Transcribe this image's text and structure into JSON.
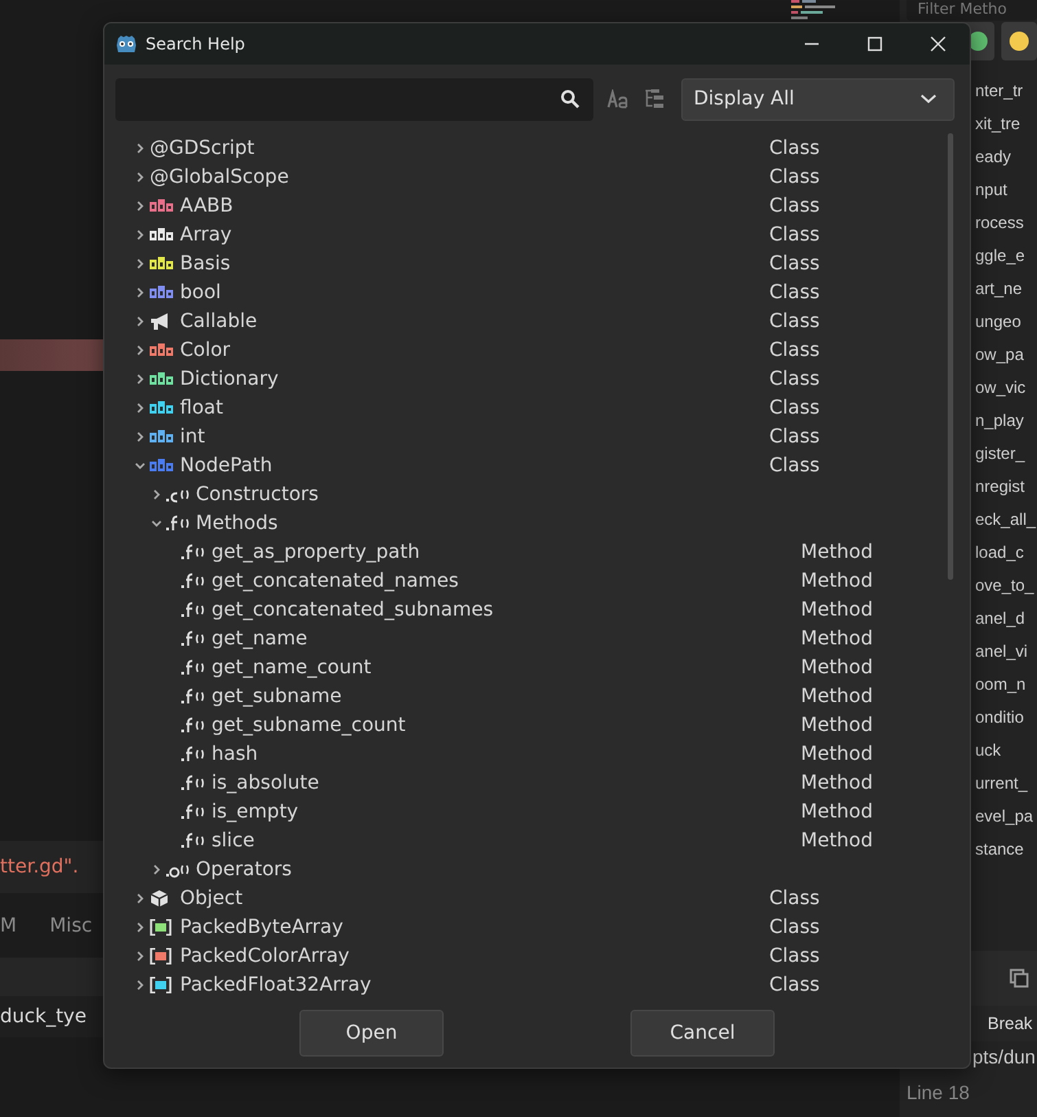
{
  "background": {
    "error_text": "tter.gd\".",
    "tabs": [
      {
        "label": "M"
      },
      {
        "label": "Misc"
      }
    ],
    "variable_text": "duck_tye",
    "filter": {
      "placeholder": "Filter Metho"
    },
    "filter_buttons": [
      {
        "color": "#5fbf6f"
      },
      {
        "color": "#f2c94c"
      }
    ],
    "methods": [
      "nter_tr",
      "xit_tre",
      "eady",
      "nput",
      "rocess",
      "ggle_e",
      "art_ne",
      "ungeo",
      "ow_pa",
      "ow_vic",
      "n_play",
      "gister_",
      "nregist",
      "eck_all_",
      "load_c",
      "ove_to_",
      "anel_d",
      "anel_vi",
      "oom_n",
      "onditio",
      "uck",
      "urrent_",
      "evel_pa",
      "stance"
    ],
    "debugger": {
      "column": "Break",
      "path": "pts/dun",
      "line": "Line 18"
    }
  },
  "window": {
    "title": "Search Help"
  },
  "search": {
    "filter": "Display All"
  },
  "tree": [
    {
      "name": "@GDScript",
      "type": "Class",
      "kind": "plain",
      "expanded": false
    },
    {
      "name": "@GlobalScope",
      "type": "Class",
      "kind": "plain",
      "expanded": false
    },
    {
      "name": "AABB",
      "type": "Class",
      "kind": "builtin",
      "color": "#e86f8a",
      "expanded": false
    },
    {
      "name": "Array",
      "type": "Class",
      "kind": "builtin",
      "color": "#e8e8e8",
      "expanded": false
    },
    {
      "name": "Basis",
      "type": "Class",
      "kind": "builtin",
      "color": "#e2e84a",
      "expanded": false
    },
    {
      "name": "bool",
      "type": "Class",
      "kind": "builtin",
      "color": "#7f8ef0",
      "expanded": false
    },
    {
      "name": "Callable",
      "type": "Class",
      "kind": "callable",
      "expanded": false
    },
    {
      "name": "Color",
      "type": "Class",
      "kind": "builtin",
      "color": "#f07a6a",
      "expanded": false
    },
    {
      "name": "Dictionary",
      "type": "Class",
      "kind": "builtin",
      "color": "#6fe0a0",
      "expanded": false
    },
    {
      "name": "float",
      "type": "Class",
      "kind": "builtin",
      "color": "#40d0f0",
      "expanded": false
    },
    {
      "name": "int",
      "type": "Class",
      "kind": "builtin",
      "color": "#5fb0f0",
      "expanded": false
    },
    {
      "name": "NodePath",
      "type": "Class",
      "kind": "builtin",
      "color": "#4a7cf0",
      "expanded": true,
      "children": [
        {
          "name": "Constructors",
          "kind": "constructor",
          "expanded": false
        },
        {
          "name": "Methods",
          "kind": "method",
          "expanded": true,
          "children": [
            {
              "name": "get_as_property_path",
              "type": "Method",
              "kind": "method"
            },
            {
              "name": "get_concatenated_names",
              "type": "Method",
              "kind": "method"
            },
            {
              "name": "get_concatenated_subnames",
              "type": "Method",
              "kind": "method"
            },
            {
              "name": "get_name",
              "type": "Method",
              "kind": "method"
            },
            {
              "name": "get_name_count",
              "type": "Method",
              "kind": "method"
            },
            {
              "name": "get_subname",
              "type": "Method",
              "kind": "method"
            },
            {
              "name": "get_subname_count",
              "type": "Method",
              "kind": "method"
            },
            {
              "name": "hash",
              "type": "Method",
              "kind": "method"
            },
            {
              "name": "is_absolute",
              "type": "Method",
              "kind": "method"
            },
            {
              "name": "is_empty",
              "type": "Method",
              "kind": "method"
            },
            {
              "name": "slice",
              "type": "Method",
              "kind": "method"
            }
          ]
        },
        {
          "name": "Operators",
          "kind": "operator",
          "expanded": false
        }
      ]
    },
    {
      "name": "Object",
      "type": "Class",
      "kind": "object",
      "expanded": false
    },
    {
      "name": "PackedByteArray",
      "type": "Class",
      "kind": "packed",
      "color": "#8ee07a",
      "expanded": false
    },
    {
      "name": "PackedColorArray",
      "type": "Class",
      "kind": "packed",
      "color": "#f07a6a",
      "expanded": false
    },
    {
      "name": "PackedFloat32Array",
      "type": "Class",
      "kind": "packed",
      "color": "#40d0f0",
      "expanded": false
    }
  ],
  "buttons": [
    "Open",
    "Cancel"
  ]
}
